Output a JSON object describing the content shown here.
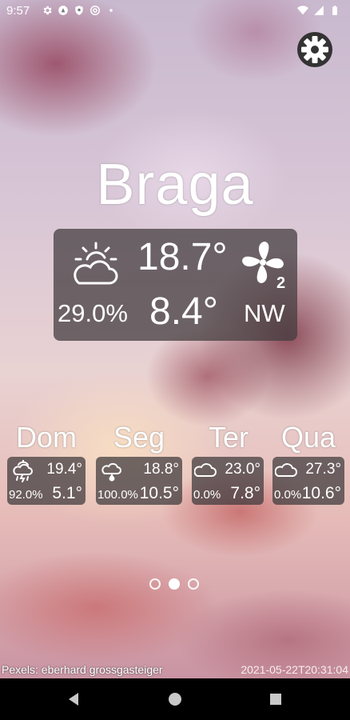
{
  "status_bar": {
    "time": "9:57",
    "left_icons": [
      "gear-icon",
      "assistant-icon",
      "shield-icon",
      "at-icon"
    ],
    "right_icons": [
      "wifi-icon",
      "signal-icon",
      "battery-icon"
    ]
  },
  "settings": {
    "icon": "gear-icon"
  },
  "city": "Braga",
  "current": {
    "condition_icon": "partly-cloudy-day-icon",
    "temp_max": "18.7°",
    "wind_icon": "wind-fan-icon",
    "wind_force": "2",
    "humidity": "29.0%",
    "temp_min": "8.4°",
    "wind_direction": "NW"
  },
  "forecast": [
    {
      "day": "Dom",
      "icon": "thunder-rain-icon",
      "max": "19.4°",
      "humidity": "92.0%",
      "min": "5.1°"
    },
    {
      "day": "Seg",
      "icon": "rain-cloud-icon",
      "max": "18.8°",
      "humidity": "100.0%",
      "min": "10.5°"
    },
    {
      "day": "Ter",
      "icon": "cloud-icon",
      "max": "23.0°",
      "humidity": "0.0%",
      "min": "7.8°"
    },
    {
      "day": "Qua",
      "icon": "cloud-icon",
      "max": "27.3°",
      "humidity": "0.0%",
      "min": "10.6°"
    }
  ],
  "pager": {
    "pages": 3,
    "active_index": 1
  },
  "footer": {
    "credit": "Pexels: eberhard grossgasteiger",
    "timestamp": "2021-05-22T20:31:04"
  },
  "navbar": [
    "back-icon",
    "home-icon",
    "recents-icon"
  ]
}
